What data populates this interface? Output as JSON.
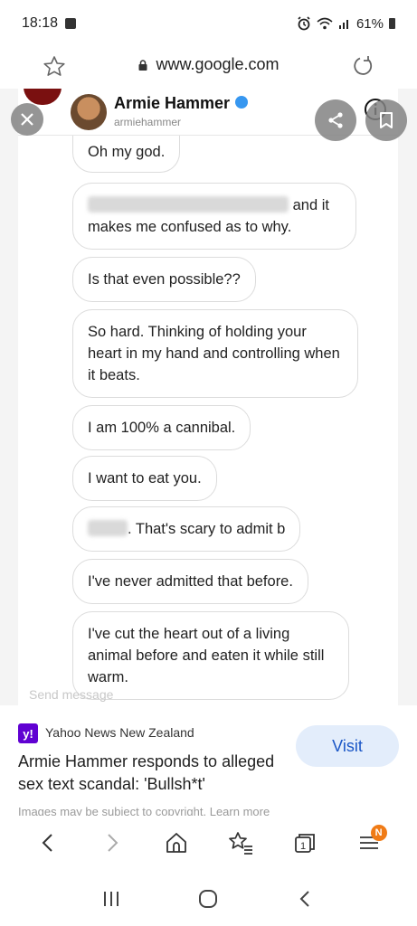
{
  "status_bar": {
    "time": "18:18",
    "battery": "61%",
    "icons": [
      "alarm-icon",
      "wifi-icon",
      "signal-icon",
      "battery-icon"
    ]
  },
  "browser": {
    "url": "www.google.com"
  },
  "screenshot": {
    "name": "Armie Hammer",
    "handle": "armiehammer",
    "messages": [
      {
        "text": "Oh my god."
      },
      {
        "text_line1_suffix": "and it",
        "text_line2": "makes me confused as to why."
      },
      {
        "text": "Is that even possible??"
      },
      {
        "text": "So hard. Thinking of holding your heart in my hand and controlling when it beats."
      },
      {
        "text": "I am 100% a cannibal."
      },
      {
        "text": "I want to eat you."
      },
      {
        "text_suffix": ". That's scary to admit b"
      },
      {
        "text": "I've never admitted that before."
      },
      {
        "text": "I've cut the heart out of a living animal before and eaten it while still warm."
      }
    ],
    "send_placeholder": "Send message"
  },
  "source": {
    "logo_text": "y!",
    "site": "Yahoo News New Zealand",
    "title": "Armie Hammer responds to alleged sex text scandal: 'Bullsh*t'",
    "visit_label": "Visit",
    "copyright": "Images may be subject to copyright. Learn more"
  },
  "toolbar": {
    "tabs_count": "1",
    "menu_badge": "N"
  },
  "colors": {
    "yahoo_purple": "#6001d2",
    "visit_bg": "#e3edfb",
    "visit_text": "#1a56c6",
    "badge_orange": "#f07b16",
    "verified_blue": "#3797f0"
  }
}
